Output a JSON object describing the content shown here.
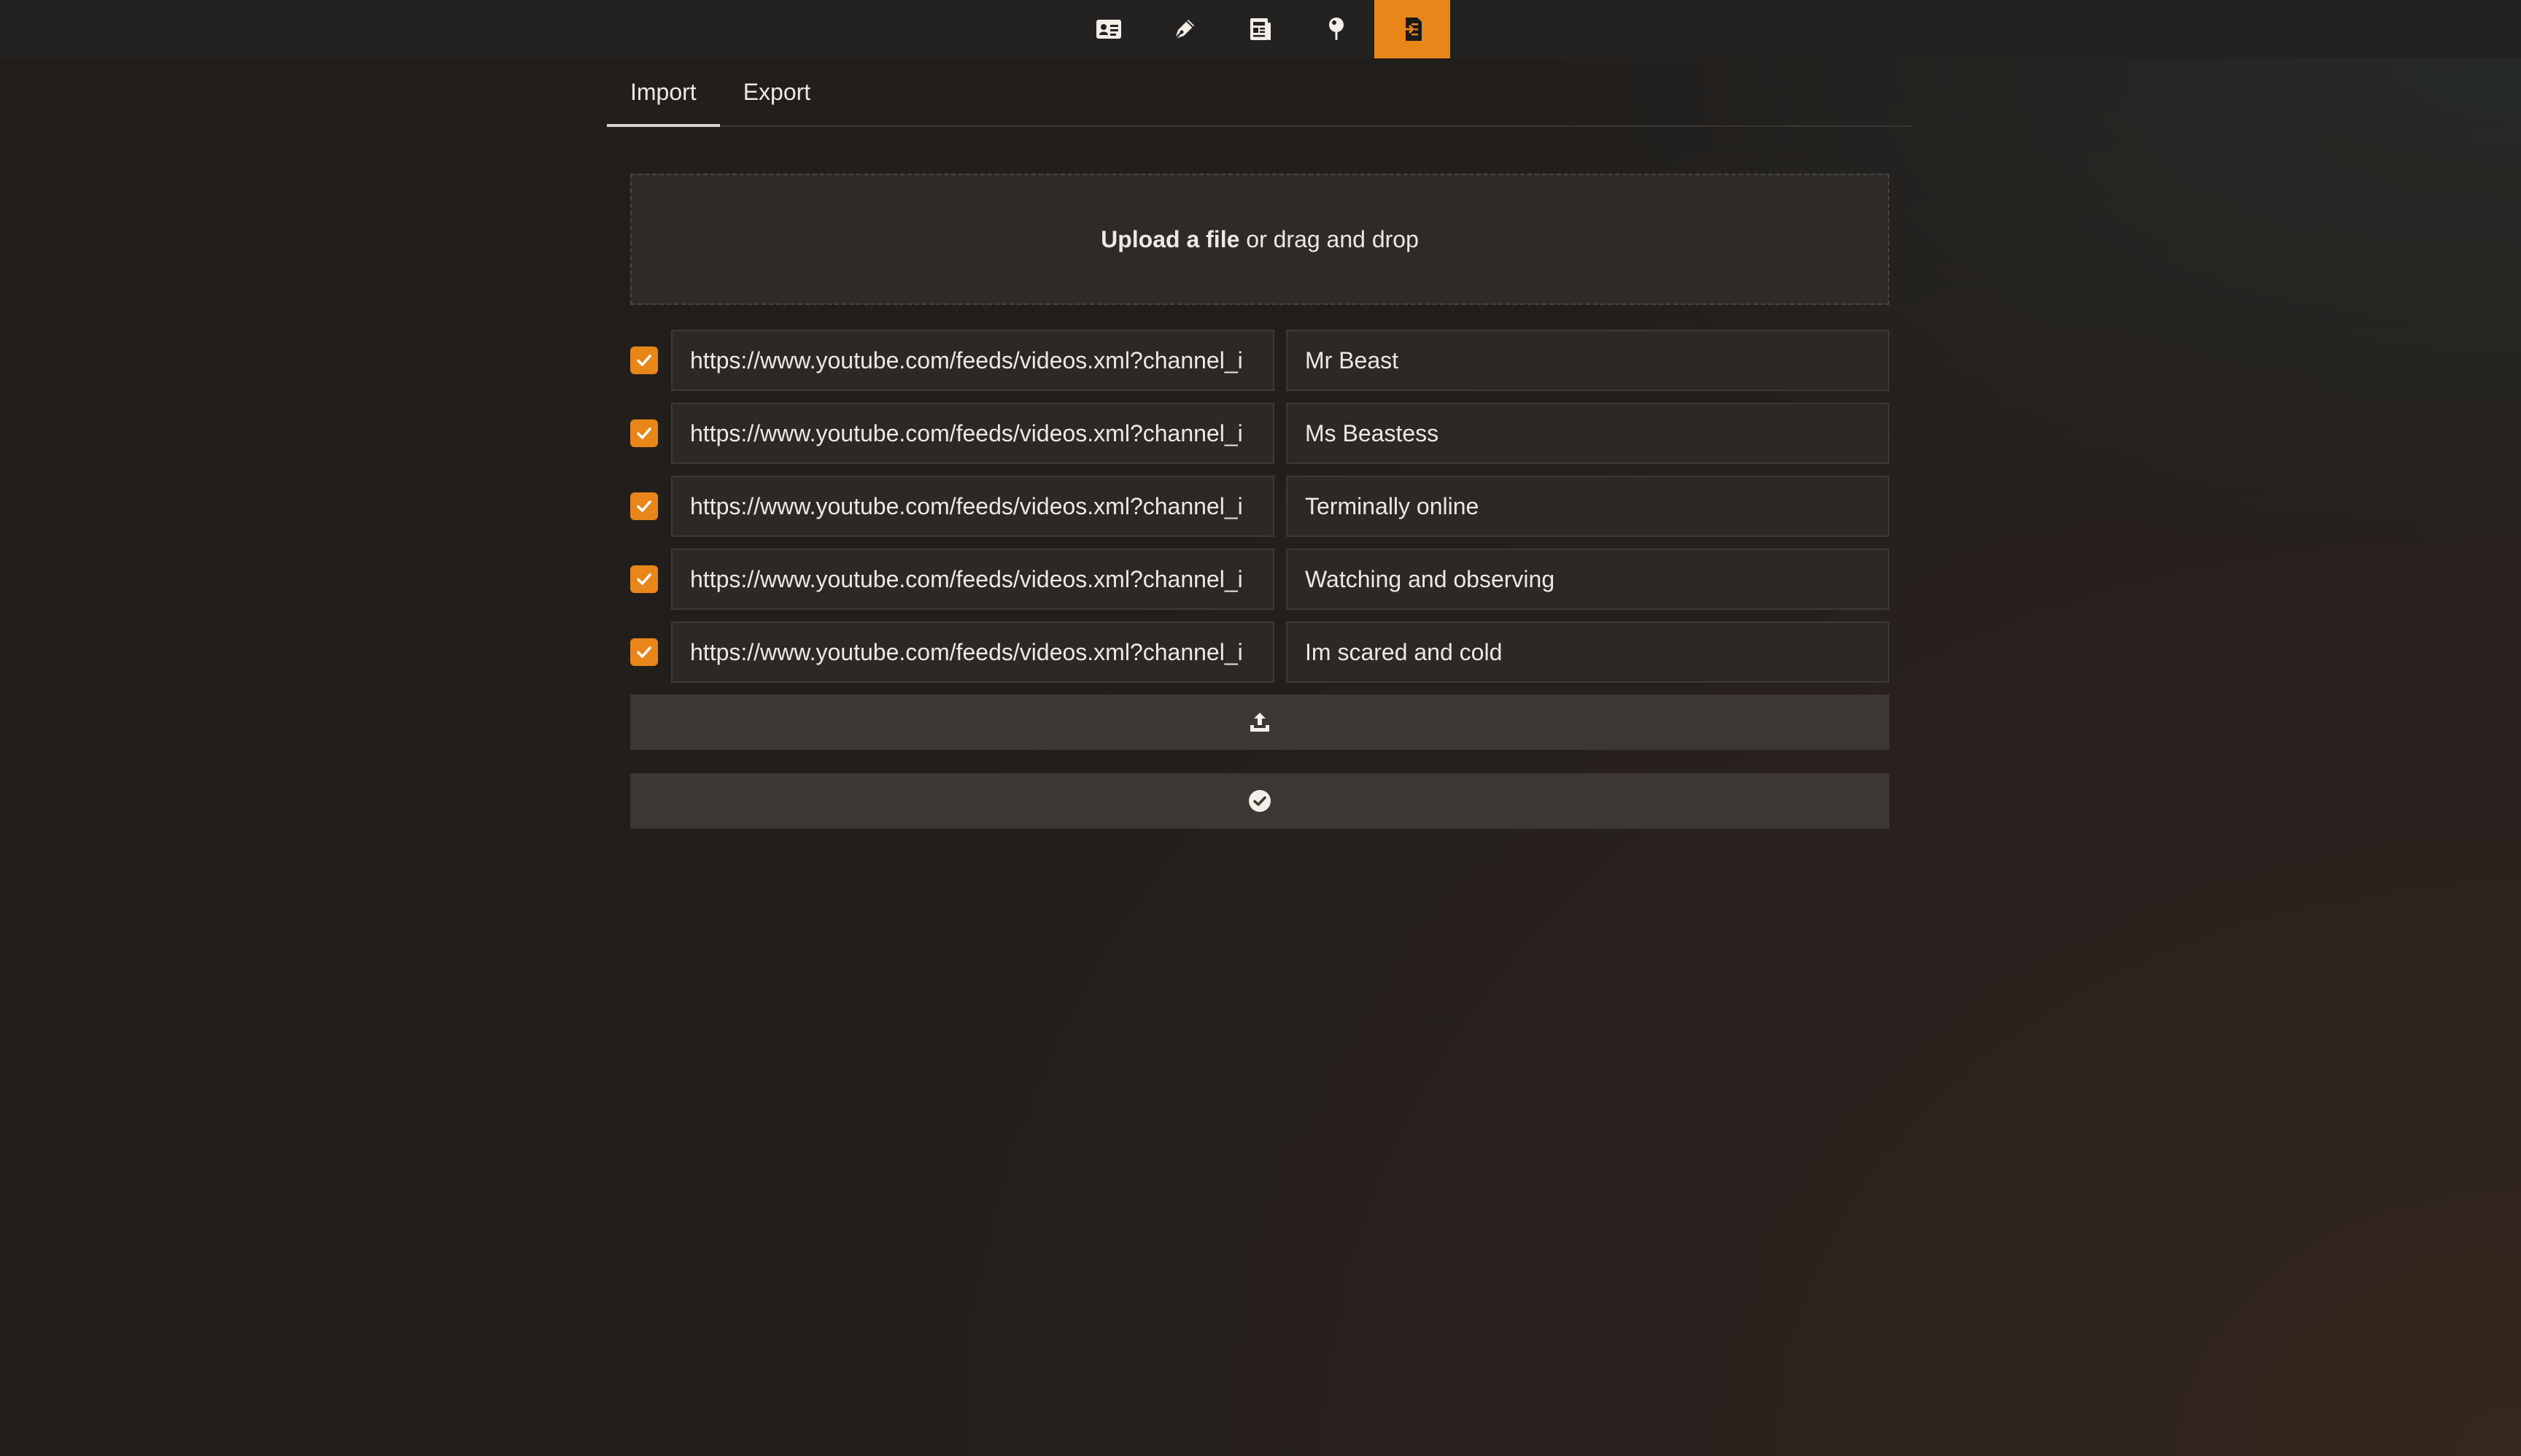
{
  "nav": {
    "items": [
      {
        "icon": "contact-card-icon",
        "active": false
      },
      {
        "icon": "pen-icon",
        "active": false
      },
      {
        "icon": "newspaper-icon",
        "active": false
      },
      {
        "icon": "map-pin-icon",
        "active": false
      },
      {
        "icon": "import-export-icon",
        "active": true
      }
    ],
    "accent_color": "#e8861a"
  },
  "tabs": [
    {
      "label": "Import",
      "active": true
    },
    {
      "label": "Export",
      "active": false
    }
  ],
  "dropzone": {
    "upload_label": "Upload a file",
    "drag_label": " or drag and drop"
  },
  "feeds": [
    {
      "checked": true,
      "url": "https://www.youtube.com/feeds/videos.xml?channel_i",
      "name": "Mr Beast"
    },
    {
      "checked": true,
      "url": "https://www.youtube.com/feeds/videos.xml?channel_i",
      "name": "Ms Beastess"
    },
    {
      "checked": true,
      "url": "https://www.youtube.com/feeds/videos.xml?channel_i",
      "name": "Terminally online"
    },
    {
      "checked": true,
      "url": "https://www.youtube.com/feeds/videos.xml?channel_i",
      "name": "Watching and observing"
    },
    {
      "checked": true,
      "url": "https://www.youtube.com/feeds/videos.xml?channel_i",
      "name": "Im scared and cold"
    }
  ],
  "actions": {
    "upload_icon": "upload-tray-icon",
    "confirm_icon": "check-circle-icon"
  }
}
